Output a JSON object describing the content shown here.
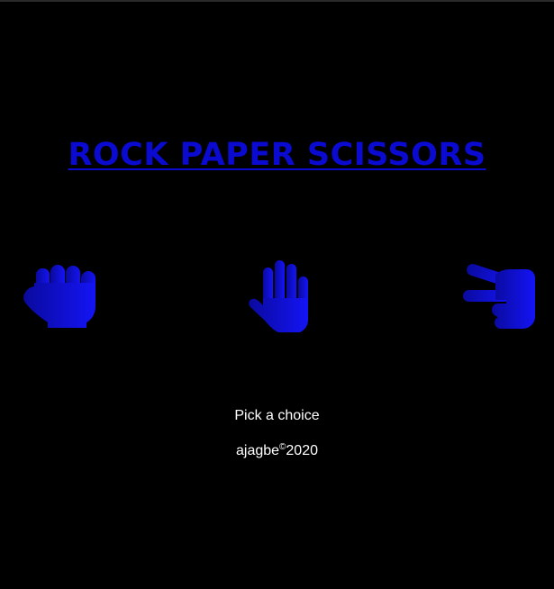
{
  "game": {
    "title": "ROCK PAPER SCISSORS",
    "status_text": "Pick a choice",
    "accent_color": "#0a0ad0",
    "background_color": "#000000"
  },
  "choices": [
    {
      "id": "rock",
      "icon": "hand-fist-icon"
    },
    {
      "id": "paper",
      "icon": "hand-paper-icon"
    },
    {
      "id": "scissors",
      "icon": "hand-scissors-icon"
    }
  ],
  "footer": {
    "author": "ajagbe",
    "copyright_symbol": "©",
    "year": "2020"
  }
}
